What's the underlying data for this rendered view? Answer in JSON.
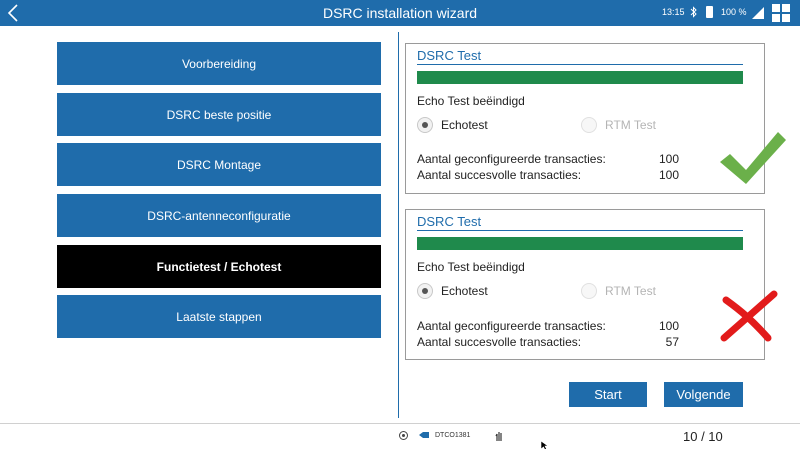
{
  "titlebar": {
    "title": "DSRC installation wizard",
    "time": "13:15",
    "battery": "100 %"
  },
  "menu": {
    "items": [
      {
        "label": "Voorbereiding",
        "active": false
      },
      {
        "label": "DSRC beste positie",
        "active": false
      },
      {
        "label": "DSRC Montage",
        "active": false
      },
      {
        "label": "DSRC-antenneconfiguratie",
        "active": false
      },
      {
        "label": "Functietest / Echotest",
        "active": true
      },
      {
        "label": "Laatste stappen",
        "active": false
      }
    ]
  },
  "panels": [
    {
      "title": "DSRC Test",
      "progress": 1.0,
      "status": "Echo Test beëindigd",
      "radio_echo": "Echotest",
      "radio_rtm": "RTM Test",
      "configured_label": "Aantal geconfigureerde transacties:",
      "configured_value": "100",
      "success_label": "Aantal succesvolle transacties:",
      "success_value": "100",
      "result": "success",
      "result_color": "#6bb04a"
    },
    {
      "title": "DSRC Test",
      "progress": 1.0,
      "status": "Echo Test beëindigd",
      "radio_echo": "Echotest",
      "radio_rtm": "RTM Test",
      "configured_label": "Aantal geconfigureerde transacties:",
      "configured_value": "100",
      "success_label": "Aantal succesvolle transacties:",
      "success_value": "57",
      "result": "failure",
      "result_color": "#e21b1b"
    }
  ],
  "actions": {
    "start": "Start",
    "next": "Volgende"
  },
  "footer": {
    "device_id": "DTCO1381",
    "page": "10 / 10"
  },
  "colors": {
    "primary": "#1f6cab",
    "progress": "#1f8a4c",
    "active_menu": "#000000"
  }
}
